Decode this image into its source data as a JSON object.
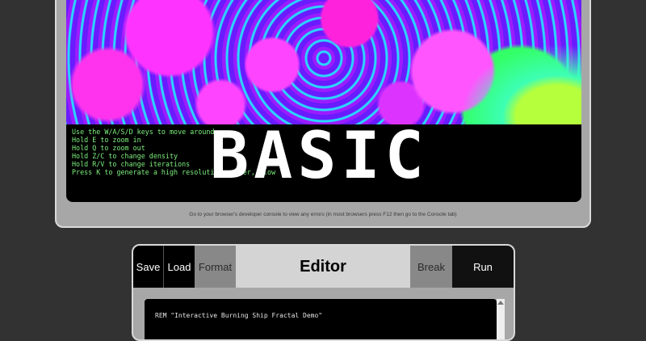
{
  "console": {
    "title": "BASIC",
    "lines": [
      "Use the W/A/S/D keys to move around",
      "Hold E to zoom in",
      "Hold Q to zoom out",
      "Hold Z/C to change density",
      "Hold R/V to change iterations",
      "Press K to generate a high resolution render, slow"
    ]
  },
  "help_text": "Go to your browser's developer console to view any errors (in most browsers press F12 then go to the Console tab)",
  "editor": {
    "buttons": {
      "save": "Save",
      "load": "Load",
      "format": "Format",
      "break": "Break",
      "run": "Run"
    },
    "title": "Editor",
    "code_first_line": "REM \"Interactive Burning Ship Fractal Demo\""
  },
  "colors": {
    "background": "#323232",
    "frame": "#a7a7a7",
    "console_text": "#7df07d"
  }
}
